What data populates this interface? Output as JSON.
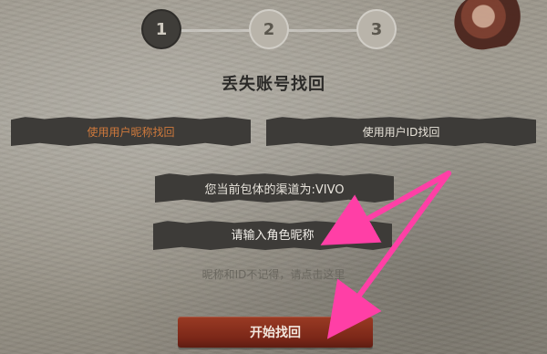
{
  "steps": [
    "1",
    "2",
    "3"
  ],
  "title": "丢失账号找回",
  "tabs": {
    "left_label": "使用用户昵称找回",
    "right_label": "使用用户ID找回"
  },
  "channel_text": "您当前包体的渠道为:VIVO",
  "nickname_input": {
    "placeholder": "请输入角色昵称"
  },
  "help_link": "昵称和ID不记得，请点击这里",
  "start_button": "开始找回",
  "colors": {
    "arrow": "#ff3fa6",
    "active_tab_text": "#d07a3c",
    "start_button": "#8a2f1d"
  }
}
